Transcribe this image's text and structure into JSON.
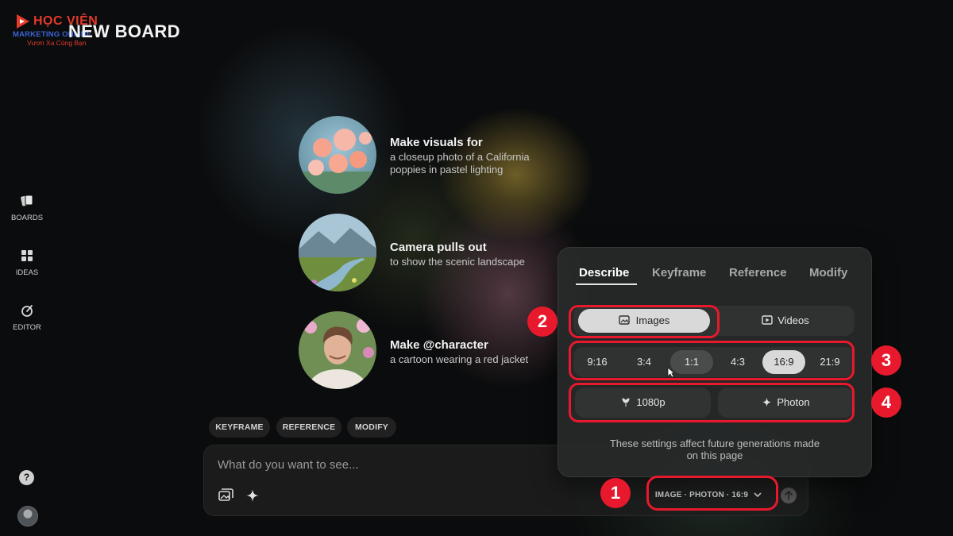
{
  "brand": {
    "name": "HỌC VIỆN",
    "sub": "MARKETING ONLINE",
    "tagline": "Vươn Xa Cùng Bạn"
  },
  "board_title": "NEW BOARD",
  "sidebar": {
    "items": [
      {
        "label": "BOARDS",
        "icon": "boards-icon"
      },
      {
        "label": "IDEAS",
        "icon": "ideas-icon"
      },
      {
        "label": "EDITOR",
        "icon": "editor-icon"
      }
    ],
    "help_label": "?"
  },
  "suggestions": [
    {
      "title": "Make visuals for",
      "description": "a closeup photo of a California poppies in pastel lighting"
    },
    {
      "title": "Camera pulls out",
      "description": "to show the scenic landscape"
    },
    {
      "title": "Make @character",
      "description": "a cartoon wearing a red jacket"
    }
  ],
  "mode_chips": [
    "KEYFRAME",
    "REFERENCE",
    "MODIFY"
  ],
  "prompt": {
    "placeholder": "What do you want to see...",
    "value": "",
    "settings_label": "IMAGE · PHOTON · 16:9"
  },
  "panel": {
    "tabs": [
      "Describe",
      "Keyframe",
      "Reference",
      "Modify"
    ],
    "active_tab": "Describe",
    "media_types": [
      "Images",
      "Videos"
    ],
    "selected_media": "Images",
    "aspect_ratios": [
      "9:16",
      "3:4",
      "1:1",
      "4:3",
      "16:9",
      "21:9"
    ],
    "selected_ratio": "16:9",
    "hover_ratio": "1:1",
    "resolution": "1080p",
    "model": "Photon",
    "note": "These settings affect future generations made on this page"
  },
  "annotations": [
    "1",
    "2",
    "3",
    "4"
  ],
  "colors": {
    "highlight": "#e8192c",
    "background": "#0b0c0d",
    "panel": "#282a2a"
  }
}
